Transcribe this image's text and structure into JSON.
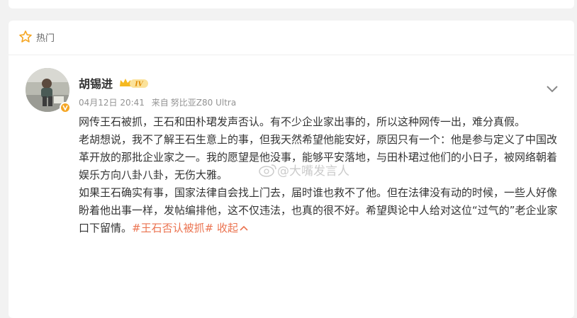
{
  "hot_section": {
    "label": "热门"
  },
  "post": {
    "author": "胡锡进",
    "level_badge": "IV",
    "date": "04月12日 20:41",
    "source_prefix": "来自",
    "source": "努比亚Z80 Ultra",
    "paragraphs": [
      "网传王石被抓，王石和田朴珺发声否认。有不少企业家出事的，所以这种网传一出，难分真假。",
      "老胡想说，我不了解王石生意上的事，但我天然希望他能安好，原因只有一个：他是参与定义了中国改革开放的那批企业家之一。我的愿望是他没事，能够平安落地，与田朴珺过他们的小日子，被网络朝着娱乐方向八卦八卦，无伤大雅。"
    ],
    "last_paragraph": "如果王石确实有事，国家法律自会找上门去，届时谁也救不了他。但在法律没有动的时候，一些人好像盼着他出事一样，发帖编排他，这不仅违法，也真的很不好。希望舆论中人给对这位“过气的”老企业家口下留情。",
    "hashtag": "#王石否认被抓#",
    "collapse_label": "收起"
  },
  "watermark": "@大嘴发言人",
  "colors": {
    "accent": "#eb7350",
    "badge": "#f5a623",
    "text": "#333333",
    "meta": "#939393"
  }
}
